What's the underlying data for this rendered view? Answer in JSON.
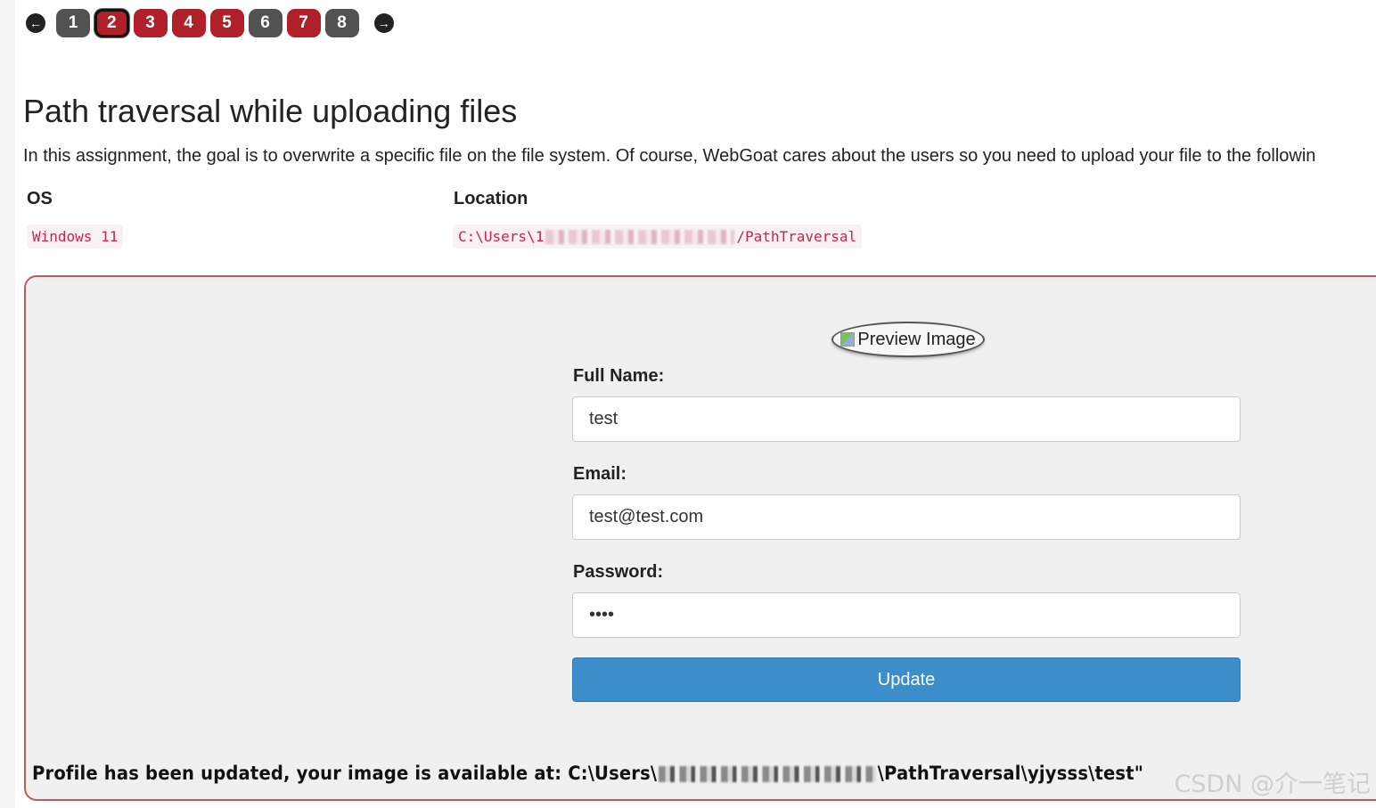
{
  "pager": {
    "prev_icon": "arrow-left-icon",
    "next_icon": "arrow-right-icon",
    "pages": [
      {
        "label": "1",
        "color": "#525252"
      },
      {
        "label": "2",
        "color": "#b0202a",
        "selected": true
      },
      {
        "label": "3",
        "color": "#b0202a"
      },
      {
        "label": "4",
        "color": "#b0202a"
      },
      {
        "label": "5",
        "color": "#b0202a"
      },
      {
        "label": "6",
        "color": "#525252"
      },
      {
        "label": "7",
        "color": "#b0202a"
      },
      {
        "label": "8",
        "color": "#525252"
      }
    ]
  },
  "lesson": {
    "title": "Path traversal while uploading files",
    "intro": "In this assignment, the goal is to overwrite a specific file on the file system. Of course, WebGoat cares about the users so you need to upload your file to the followin"
  },
  "info_table": {
    "os_header": "OS",
    "location_header": "Location",
    "os_value": "Windows 11",
    "location_prefix": "C:\\Users\\1",
    "location_suffix": "/PathTraversal"
  },
  "form": {
    "preview_alt": "Preview Image",
    "full_name_label": "Full Name:",
    "full_name_value": "test",
    "email_label": "Email:",
    "email_value": "test@test.com",
    "password_label": "Password:",
    "password_value": "test",
    "update_label": "Update"
  },
  "feedback": {
    "prefix": "Profile has been updated, your image is available at: C:\\Users\\",
    "suffix": "\\PathTraversal\\yjysss\\test\""
  },
  "watermark": "CSDN @介一笔记",
  "colors": {
    "accent_red": "#b0202a",
    "pill_gray": "#525252",
    "button_blue": "#3b8ec9",
    "panel_border": "#b56060",
    "code_text": "#c7254e"
  }
}
